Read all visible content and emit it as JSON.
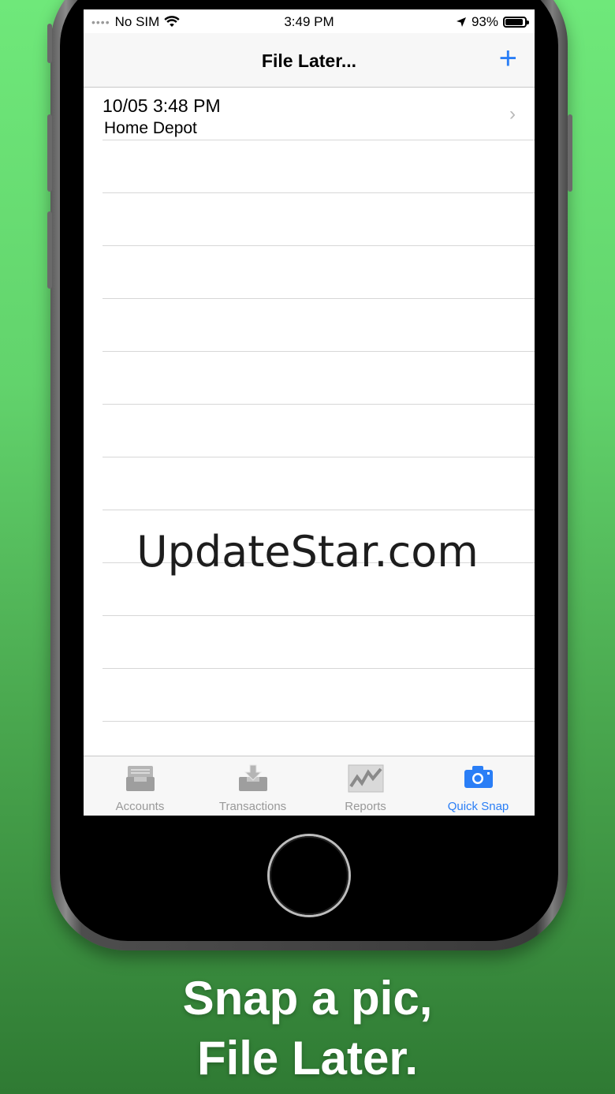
{
  "status_bar": {
    "signal_dots": "••••",
    "carrier": "No SIM",
    "time": "3:49 PM",
    "battery_percent": "93%",
    "battery_level": 0.93
  },
  "navbar": {
    "title": "File Later...",
    "add_label": "+"
  },
  "list": {
    "items": [
      {
        "date": "10/05  3:48 PM",
        "name": "Home Depot",
        "chevron": "›"
      }
    ],
    "empty_rows": 11
  },
  "tabbar": {
    "tabs": [
      {
        "label": "Accounts",
        "icon": "inbox-tray-icon",
        "active": false
      },
      {
        "label": "Transactions",
        "icon": "download-tray-icon",
        "active": false
      },
      {
        "label": "Reports",
        "icon": "line-chart-icon",
        "active": false
      },
      {
        "label": "Quick Snap",
        "icon": "camera-icon",
        "active": true
      }
    ]
  },
  "watermark": "UpdateStar.com",
  "tagline": {
    "line1": "Snap a pic,",
    "line2": "File Later."
  },
  "colors": {
    "accent": "#2a7ef6",
    "inactive_tab": "#999999",
    "background_top": "#6fe87a",
    "background_bottom": "#2f7a33"
  }
}
